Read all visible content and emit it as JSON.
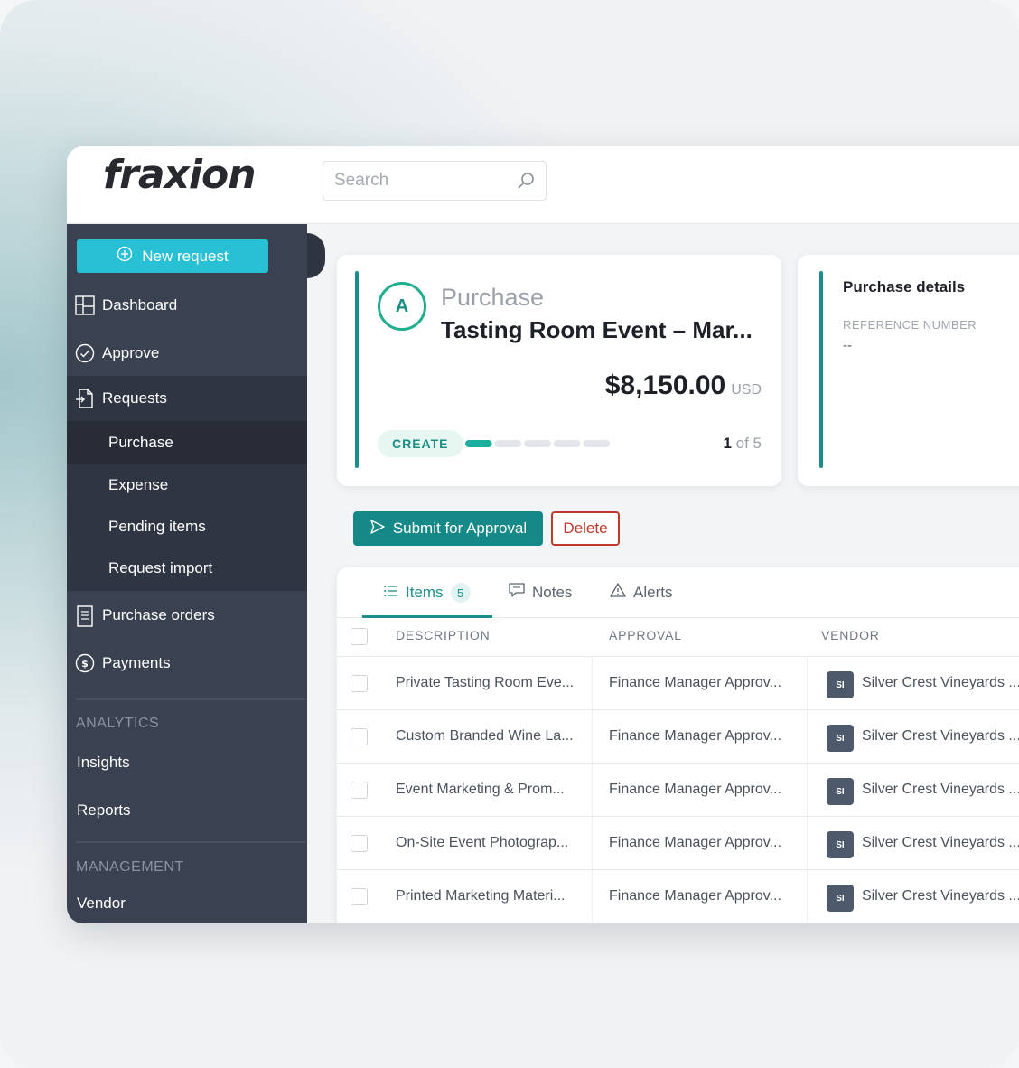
{
  "app": {
    "logo": "fraxion",
    "search": {
      "placeholder": "Search"
    }
  },
  "sidebar": {
    "new_request": "New request",
    "items": [
      {
        "label": "Dashboard",
        "icon": "dashboard-icon"
      },
      {
        "label": "Approve",
        "icon": "check-circle-icon"
      },
      {
        "label": "Requests",
        "icon": "document-icon"
      }
    ],
    "requests_sub": [
      "Purchase",
      "Expense",
      "Pending items",
      "Request import"
    ],
    "more_items": [
      {
        "label": "Purchase orders",
        "icon": "list-document-icon"
      },
      {
        "label": "Payments",
        "icon": "dollar-circle-icon"
      }
    ],
    "analytics_label": "ANALYTICS",
    "analytics_items": [
      "Insights",
      "Reports"
    ],
    "management_label": "MANAGEMENT",
    "management_items": [
      "Vendor"
    ]
  },
  "request": {
    "avatar_letter": "A",
    "type": "Purchase",
    "title": "Tasting Room Event – Mar...",
    "amount": "$8,150.00",
    "currency": "USD",
    "stage": "CREATE",
    "step_current": "1",
    "step_total": "of 5",
    "progress_fraction": 0.2
  },
  "details": {
    "title": "Purchase details",
    "reference_label": "REFERENCE NUMBER",
    "reference_value": "--"
  },
  "actions": {
    "submit": "Submit for Approval",
    "delete": "Delete"
  },
  "tabs": [
    {
      "label": "Items",
      "count": "5"
    },
    {
      "label": "Notes"
    },
    {
      "label": "Alerts"
    }
  ],
  "table": {
    "headers": [
      "DESCRIPTION",
      "APPROVAL",
      "VENDOR"
    ],
    "rows": [
      {
        "description": "Private Tasting Room Eve...",
        "approval": "Finance Manager Approv...",
        "vendor_initials": "SI",
        "vendor": "Silver Crest Vineyards ..."
      },
      {
        "description": "Custom Branded Wine La...",
        "approval": "Finance Manager Approv...",
        "vendor_initials": "SI",
        "vendor": "Silver Crest Vineyards ..."
      },
      {
        "description": "Event Marketing & Prom...",
        "approval": "Finance Manager Approv...",
        "vendor_initials": "SI",
        "vendor": "Silver Crest Vineyards ..."
      },
      {
        "description": "On-Site Event Photograp...",
        "approval": "Finance Manager Approv...",
        "vendor_initials": "SI",
        "vendor": "Silver Crest Vineyards ..."
      },
      {
        "description": "Printed Marketing Materi...",
        "approval": "Finance Manager Approv...",
        "vendor_initials": "SI",
        "vendor": "Silver Crest Vineyards ..."
      }
    ]
  },
  "colors": {
    "accent_teal": "#158888",
    "new_request_cyan": "#28c0d4",
    "sidebar_bg": "#3a4150",
    "danger": "#c0392b"
  }
}
